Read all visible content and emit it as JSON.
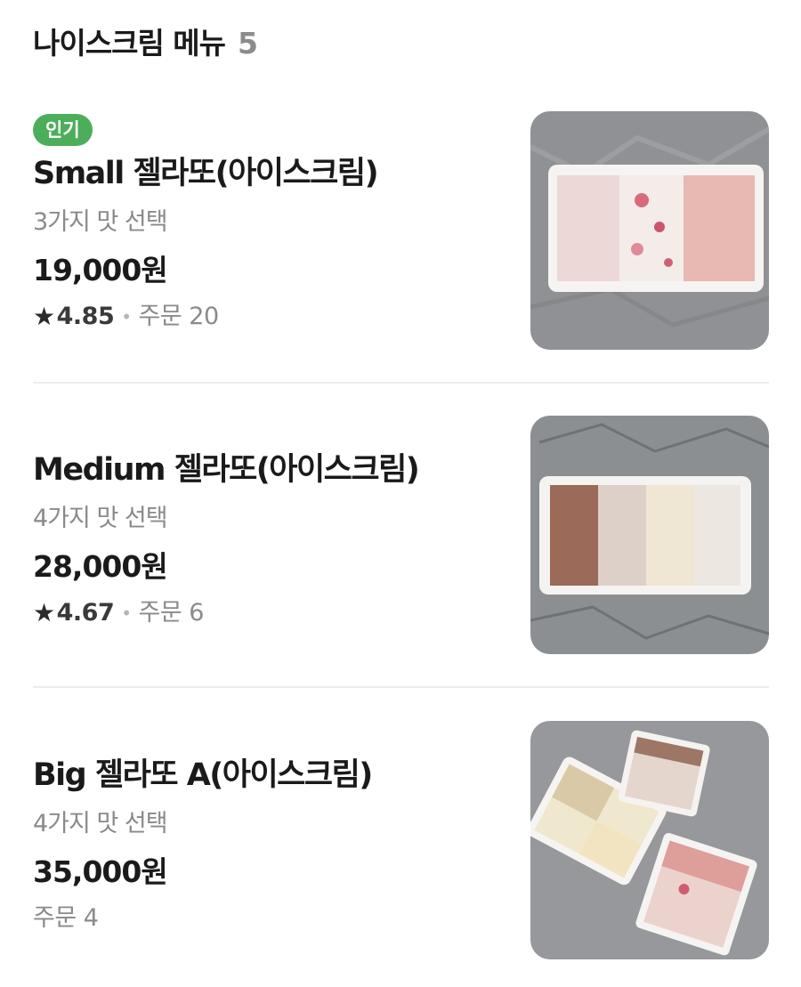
{
  "header": {
    "title": "나이스크림 메뉴",
    "count": "5"
  },
  "items": [
    {
      "badge": "인기",
      "name": "Small 젤라또(아이스크림)",
      "desc": "3가지 맛 선택",
      "price": "19,000원",
      "rating": "4.85",
      "orders": "주문 20",
      "image_icon": "gelato-3flavor-photo"
    },
    {
      "name": "Medium 젤라또(아이스크림)",
      "desc": "4가지 맛 선택",
      "price": "28,000원",
      "rating": "4.67",
      "orders": "주문 6",
      "image_icon": "gelato-4flavor-photo"
    },
    {
      "name": "Big 젤라또 A(아이스크림)",
      "desc": "4가지 맛 선택",
      "price": "35,000원",
      "orders": "주문 4",
      "image_icon": "gelato-boxes-photo"
    }
  ],
  "colors": {
    "badge": "#4cae5b",
    "muted": "#8a8a8a",
    "text": "#1a1a1a"
  }
}
